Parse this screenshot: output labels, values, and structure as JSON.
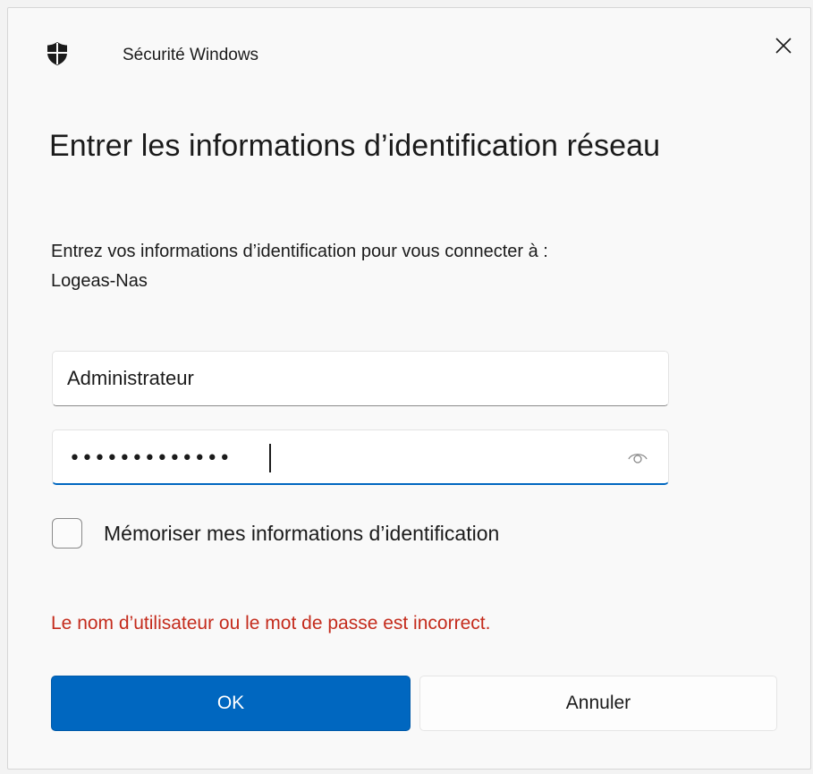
{
  "window": {
    "app_title": "Sécurité Windows",
    "close_label": "Close"
  },
  "dialog": {
    "heading": "Entrer les informations d’identification réseau",
    "subtitle_line1": "Entrez vos informations d’identification pour vous connecter à :",
    "subtitle_line2": "Logeas-Nas",
    "username": {
      "value": "Administrateur"
    },
    "password": {
      "masked_value": "•••••••••••••",
      "reveal_icon": "eye-icon"
    },
    "remember": {
      "label": "Mémoriser mes informations d’identification",
      "checked": false
    },
    "error_message": "Le nom d’utilisateur ou le mot de passe est incorrect.",
    "buttons": {
      "ok": "OK",
      "cancel": "Annuler"
    }
  },
  "colors": {
    "accent": "#0067c0",
    "error": "#c42b1c",
    "background": "#f9f9f9"
  }
}
